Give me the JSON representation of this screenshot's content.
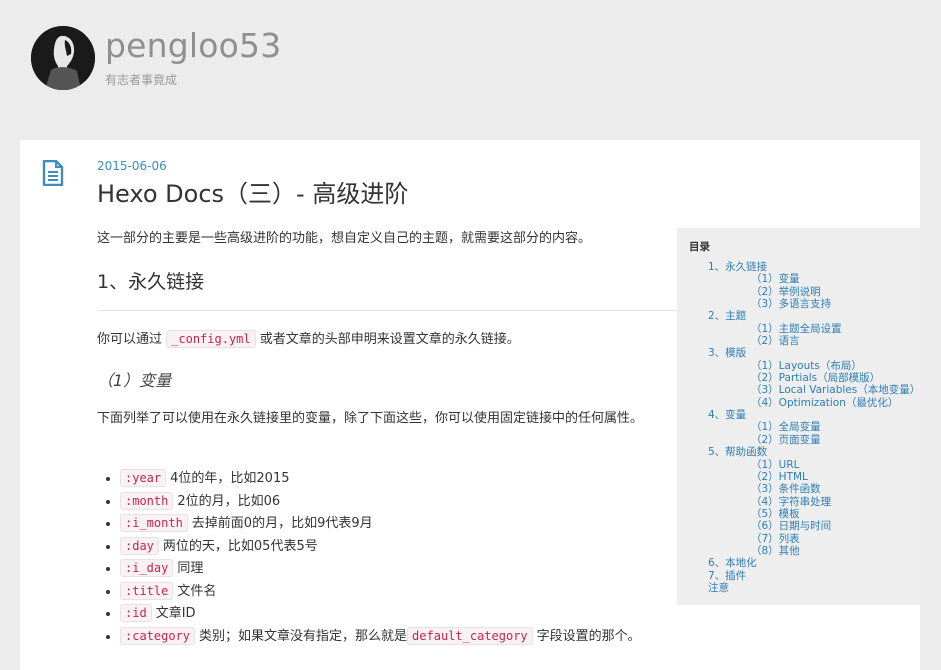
{
  "site": {
    "title": "pengloo53",
    "subtitle": "有志者事竟成"
  },
  "post": {
    "date": "2015-06-06",
    "title": "Hexo Docs（三）- 高级进阶",
    "intro": "这一部分的主要是一些高级进阶的功能，想自定义自己的主题，就需要这部分的内容。",
    "h2": "1、永久链接",
    "p2_before": "你可以通过",
    "p2_code": "_config.yml",
    "p2_after": "或者文章的头部申明来设置文章的永久链接。",
    "h3": "（1）变量",
    "p3": "下面列举了可以使用在永久链接里的变量，除了下面这些，你可以使用固定链接中的任何属性。",
    "vars": [
      {
        "code": ":year",
        "desc": "4位的年，比如2015"
      },
      {
        "code": ":month",
        "desc": "2位的月，比如06"
      },
      {
        "code": ":i_month",
        "desc": "去掉前面0的月，比如9代表9月"
      },
      {
        "code": ":day",
        "desc": "两位的天，比如05代表5号"
      },
      {
        "code": ":i_day",
        "desc": "同理"
      },
      {
        "code": ":title",
        "desc": "文件名"
      },
      {
        "code": ":id",
        "desc": "文章ID"
      },
      {
        "code": ":category",
        "desc": "类别；如果文章没有指定，那么就是",
        "code2": "default_category",
        "desc2": "字段设置的那个。"
      }
    ]
  },
  "toc": {
    "title": "目录",
    "items": [
      {
        "level": 1,
        "label": "1、永久链接"
      },
      {
        "level": 2,
        "label": "（1）变量"
      },
      {
        "level": 2,
        "label": "（2）举例说明"
      },
      {
        "level": 2,
        "label": "（3）多语言支持"
      },
      {
        "level": 1,
        "label": "2、主题"
      },
      {
        "level": 2,
        "label": "（1）主题全局设置"
      },
      {
        "level": 2,
        "label": "（2）语言"
      },
      {
        "level": 1,
        "label": "3、模版"
      },
      {
        "level": 2,
        "label": "（1）Layouts（布局）"
      },
      {
        "level": 2,
        "label": "（2）Partials（局部模版）"
      },
      {
        "level": 2,
        "label": "（3）Local Variables（本地变量）"
      },
      {
        "level": 2,
        "label": "（4）Optimization（最优化）"
      },
      {
        "level": 1,
        "label": "4、变量"
      },
      {
        "level": 2,
        "label": "（1）全局变量"
      },
      {
        "level": 2,
        "label": "（2）页面变量"
      },
      {
        "level": 1,
        "label": "5、帮助函数"
      },
      {
        "level": 2,
        "label": "（1）URL"
      },
      {
        "level": 2,
        "label": "（2）HTML"
      },
      {
        "level": 2,
        "label": "（3）条件函数"
      },
      {
        "level": 2,
        "label": "（4）字符串处理"
      },
      {
        "level": 2,
        "label": "（5）模板"
      },
      {
        "level": 2,
        "label": "（6）日期与时间"
      },
      {
        "level": 2,
        "label": "（7）列表"
      },
      {
        "level": 2,
        "label": "（8）其他"
      },
      {
        "level": 1,
        "label": "6、本地化"
      },
      {
        "level": 1,
        "label": "7、插件"
      },
      {
        "level": 1,
        "label": "注意"
      }
    ]
  },
  "colors": {
    "accent": "#2f7fb5",
    "code_text": "#c7254e",
    "background": "#ececec"
  },
  "icons": {
    "avatar": "avatar",
    "post": "document-icon"
  }
}
